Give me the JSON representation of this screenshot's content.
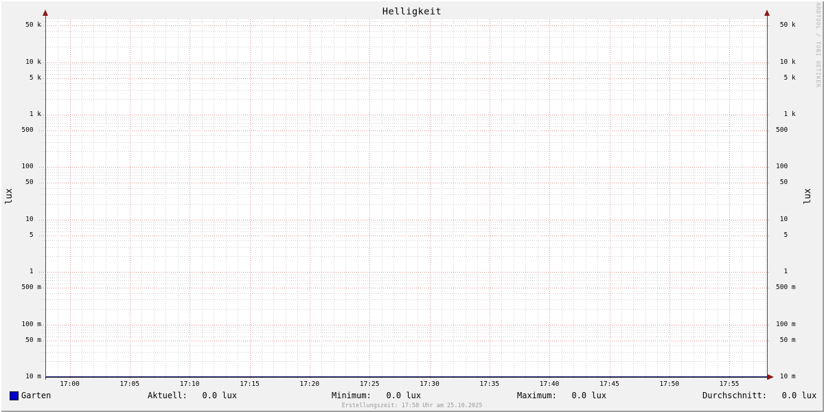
{
  "title": "Helligkeit",
  "branding": "RRDTOOL / TOBI OETIKER",
  "y_axis": {
    "unit": "lux",
    "scale": "log",
    "min": 0.01,
    "max": 65000,
    "major_ticks": [
      {
        "value": 50000,
        "label": " 50 k"
      },
      {
        "value": 10000,
        "label": " 10 k"
      },
      {
        "value": 5000,
        "label": "  5 k"
      },
      {
        "value": 1000,
        "label": "  1 k"
      },
      {
        "value": 500,
        "label": "500  "
      },
      {
        "value": 100,
        "label": "100  "
      },
      {
        "value": 50,
        "label": " 50  "
      },
      {
        "value": 10,
        "label": " 10  "
      },
      {
        "value": 5,
        "label": "  5  "
      },
      {
        "value": 1,
        "label": "  1  "
      },
      {
        "value": 0.5,
        "label": "500 m"
      },
      {
        "value": 0.1,
        "label": "100 m"
      },
      {
        "value": 0.05,
        "label": " 50 m"
      },
      {
        "value": 0.01,
        "label": " 10 m"
      }
    ]
  },
  "x_axis": {
    "major_ticks": [
      "17:00",
      "17:05",
      "17:10",
      "17:15",
      "17:20",
      "17:25",
      "17:30",
      "17:35",
      "17:40",
      "17:45",
      "17:50",
      "17:55"
    ]
  },
  "legend": {
    "series_label": "Garten",
    "series_color": "#0000cc",
    "stats": [
      "Aktuell:   0.0 lux",
      "Minimum:   0.0 lux",
      "Maximum:   0.0 lux",
      "Durchschnitt:   0.0 lux"
    ]
  },
  "footer": "Erstellungszeit: 17:58 Uhr am 25.10.2025",
  "chart_data": {
    "type": "line",
    "title": "Helligkeit",
    "ylabel": "lux",
    "yscale": "log",
    "ylim": [
      0.01,
      65000
    ],
    "x": [
      "17:00",
      "17:05",
      "17:10",
      "17:15",
      "17:20",
      "17:25",
      "17:30",
      "17:35",
      "17:40",
      "17:45",
      "17:50",
      "17:55"
    ],
    "series": [
      {
        "name": "Garten",
        "color": "#0000cc",
        "values": [
          0,
          0,
          0,
          0,
          0,
          0,
          0,
          0,
          0,
          0,
          0,
          0
        ]
      }
    ],
    "stats": {
      "aktuell": "0.0 lux",
      "minimum": "0.0 lux",
      "maximum": "0.0 lux",
      "durchschnitt": "0.0 lux"
    },
    "legend_position": "bottom",
    "grid": true
  }
}
